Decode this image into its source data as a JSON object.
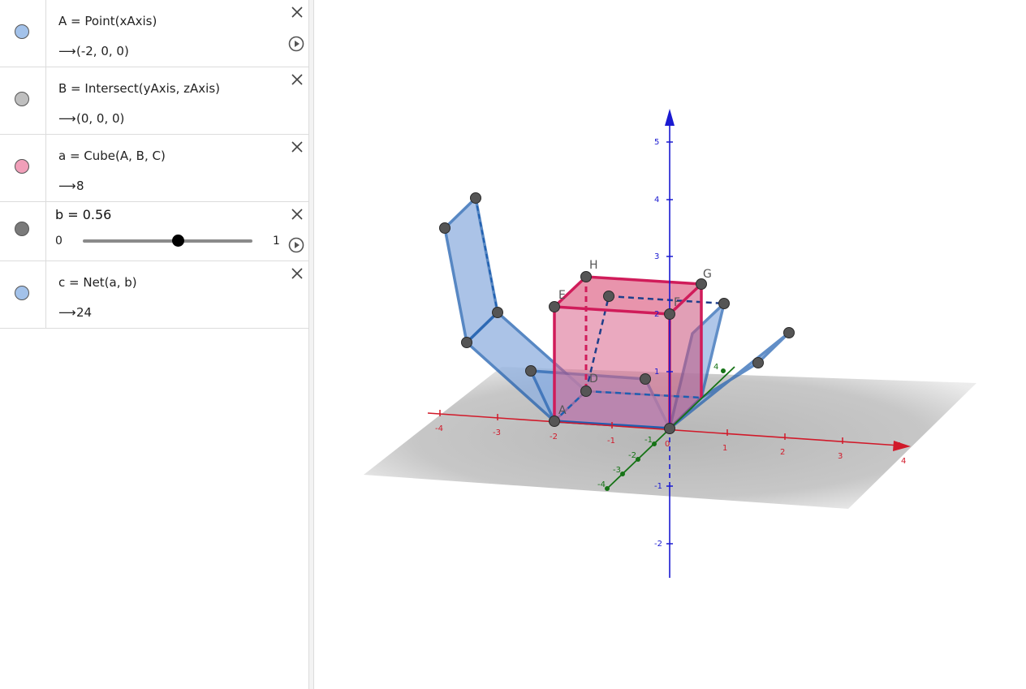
{
  "algebra": {
    "rows": [
      {
        "definition": "A = Point(xAxis)",
        "value": "(-2, 0, 0)",
        "color": "#a3c2ea"
      },
      {
        "definition": "B = Intersect(yAxis, zAxis)",
        "value": "(0, 0, 0)",
        "color": "#bfbfbf"
      },
      {
        "definition": "a = Cube(A, B, C)",
        "value": "8",
        "color": "#f19fb9"
      },
      {
        "definition": "c = Net(a, b)",
        "value": "24",
        "color": "#a3c2ea"
      }
    ],
    "slider": {
      "title": "b = 0.56",
      "min": "0",
      "max": "1",
      "value": 0.56,
      "color": "#7a7a7a"
    }
  },
  "view3d": {
    "axis_colors": {
      "x": "#d11a2a",
      "y": "#167316",
      "z": "#1a1ad1"
    },
    "x_ticks": [
      "-4",
      "-3",
      "-2",
      "-1",
      "0",
      "1",
      "2",
      "3",
      "4"
    ],
    "y_ticks": [
      "-4",
      "-3",
      "-2",
      "-1",
      "4"
    ],
    "z_ticks": [
      "5",
      "4",
      "3",
      "2",
      "1",
      "-1",
      "-2"
    ],
    "point_labels": [
      "H",
      "G",
      "E",
      "F",
      "A",
      "D"
    ],
    "cube_color": "#e0507f",
    "net_color": "#1f5fb0"
  }
}
